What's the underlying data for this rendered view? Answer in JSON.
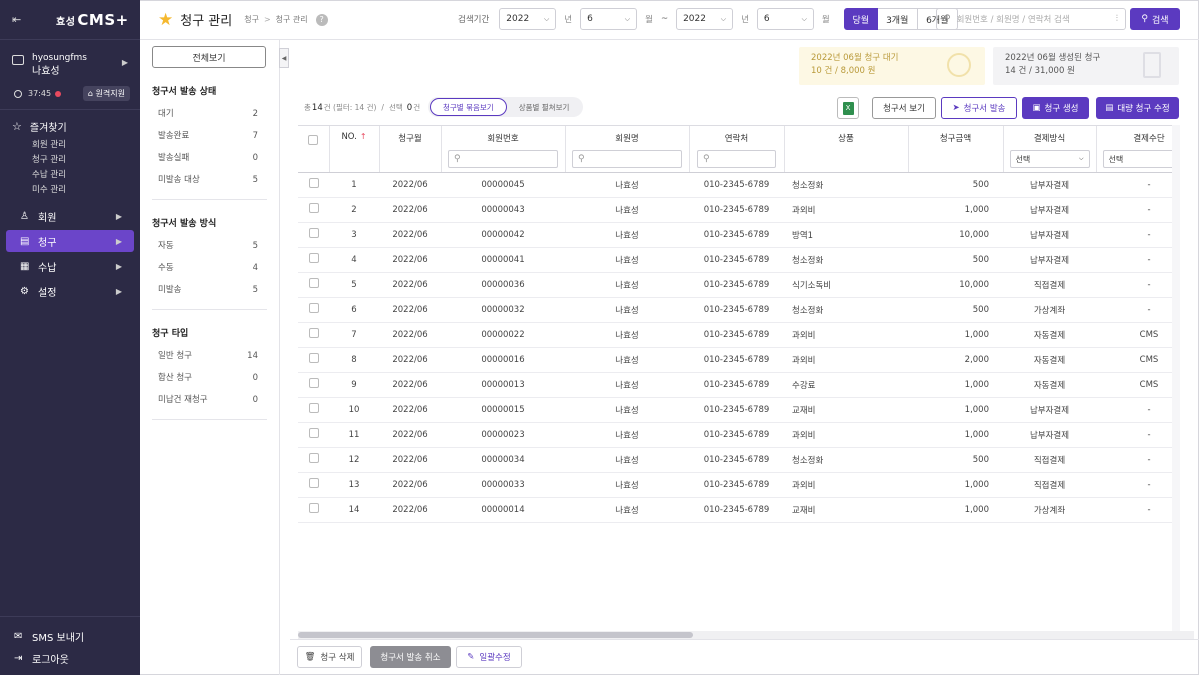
{
  "sidebar": {
    "logo_prefix": "효성",
    "logo_main": "CMS+",
    "user_id": "hyosungfms",
    "user_name": "나효성",
    "session_time": "37:45",
    "remote_label": "원격지원",
    "favorites_title": "즐겨찾기",
    "favorites": [
      "회원 관리",
      "청구 관리",
      "수납 관리",
      "미수 관리"
    ],
    "nav": [
      {
        "label": "회원",
        "icon": "user-icon"
      },
      {
        "label": "청구",
        "icon": "billing-icon",
        "active": true
      },
      {
        "label": "수납",
        "icon": "receipt-icon"
      },
      {
        "label": "설정",
        "icon": "gear-icon"
      }
    ],
    "sms_label": "SMS 보내기",
    "logout_label": "로그아웃"
  },
  "header": {
    "title": "청구 관리",
    "breadcrumb": [
      "청구",
      "청구 관리"
    ],
    "period_label": "검색기간",
    "from_year": "2022",
    "from_month": "6",
    "to_year": "2022",
    "to_month": "6",
    "year_unit": "년",
    "month_unit": "월",
    "tilde": "~",
    "quick_ranges": [
      "당월",
      "3개월",
      "6개월"
    ],
    "search_placeholder": "회원번호 / 회원명 / 연락처 검색",
    "search_button": "검색"
  },
  "filter": {
    "view_all": "전체보기",
    "groups": [
      {
        "title": "청구서 발송 상태",
        "rows": [
          {
            "label": "대기",
            "count": "2"
          },
          {
            "label": "발송완료",
            "count": "7"
          },
          {
            "label": "발송실패",
            "count": "0"
          },
          {
            "label": "미발송 대상",
            "count": "5"
          }
        ]
      },
      {
        "title": "청구서 발송 방식",
        "rows": [
          {
            "label": "자동",
            "count": "5"
          },
          {
            "label": "수동",
            "count": "4"
          },
          {
            "label": "미발송",
            "count": "5"
          }
        ]
      },
      {
        "title": "청구 타입",
        "rows": [
          {
            "label": "일반 청구",
            "count": "14"
          },
          {
            "label": "합산 청구",
            "count": "0"
          },
          {
            "label": "미납건 재청구",
            "count": "0"
          }
        ]
      }
    ]
  },
  "summary": {
    "pending_title": "2022년 06월 청구 대기",
    "pending_value": "10 건 / 8,000 원",
    "created_title": "2022년 06월 생성된 청구",
    "created_value": "14 건 / 31,000 원"
  },
  "toolbar": {
    "total_prefix": "총",
    "total_count": "14",
    "total_suffix": "건 (필터: 14 건)",
    "slash": "/",
    "selected_prefix": "선택",
    "selected_count": "0",
    "selected_suffix": "건",
    "view_modes": [
      "청구별 묶음보기",
      "상품별 펼쳐보기"
    ],
    "excel_glyph": "X",
    "view_invoice": "청구서 보기",
    "send_invoice": "청구서 발송",
    "create_bill": "청구 생성",
    "bulk_edit": "대량 청구 수정"
  },
  "table": {
    "headers": [
      "NO.",
      "청구월",
      "회원번호",
      "회원명",
      "연락처",
      "상품",
      "청구금액",
      "결제방식",
      "결제수단"
    ],
    "select_placeholder": "선택",
    "rows": [
      [
        "1",
        "2022/06",
        "00000045",
        "나효성",
        "010-2345-6789",
        "청소정화",
        "500",
        "납부자결제",
        "-"
      ],
      [
        "2",
        "2022/06",
        "00000043",
        "나효성",
        "010-2345-6789",
        "과외비",
        "1,000",
        "납부자결제",
        "-"
      ],
      [
        "3",
        "2022/06",
        "00000042",
        "나효성",
        "010-2345-6789",
        "방역1",
        "10,000",
        "납부자결제",
        "-"
      ],
      [
        "4",
        "2022/06",
        "00000041",
        "나효성",
        "010-2345-6789",
        "청소정화",
        "500",
        "납부자결제",
        "-"
      ],
      [
        "5",
        "2022/06",
        "00000036",
        "나효성",
        "010-2345-6789",
        "식기소독비",
        "10,000",
        "직접결제",
        "-"
      ],
      [
        "6",
        "2022/06",
        "00000032",
        "나효성",
        "010-2345-6789",
        "청소정화",
        "500",
        "가상계좌",
        "-"
      ],
      [
        "7",
        "2022/06",
        "00000022",
        "나효성",
        "010-2345-6789",
        "과외비",
        "1,000",
        "자동결제",
        "CMS"
      ],
      [
        "8",
        "2022/06",
        "00000016",
        "나효성",
        "010-2345-6789",
        "과외비",
        "2,000",
        "자동결제",
        "CMS"
      ],
      [
        "9",
        "2022/06",
        "00000013",
        "나효성",
        "010-2345-6789",
        "수강료",
        "1,000",
        "자동결제",
        "CMS"
      ],
      [
        "10",
        "2022/06",
        "00000015",
        "나효성",
        "010-2345-6789",
        "교재비",
        "1,000",
        "납부자결제",
        "-"
      ],
      [
        "11",
        "2022/06",
        "00000023",
        "나효성",
        "010-2345-6789",
        "과외비",
        "1,000",
        "납부자결제",
        "-"
      ],
      [
        "12",
        "2022/06",
        "00000034",
        "나효성",
        "010-2345-6789",
        "청소정화",
        "500",
        "직접결제",
        "-"
      ],
      [
        "13",
        "2022/06",
        "00000033",
        "나효성",
        "010-2345-6789",
        "과외비",
        "1,000",
        "직접결제",
        "-"
      ],
      [
        "14",
        "2022/06",
        "00000014",
        "나효성",
        "010-2345-6789",
        "교재비",
        "1,000",
        "가상계좌",
        "-"
      ]
    ]
  },
  "footer": {
    "delete_label": "청구 삭제",
    "cancel_send_label": "청구서 발송 취소",
    "batch_edit_label": "일괄수정"
  },
  "colors": {
    "accent": "#5b3ac0",
    "sidebar": "#2c2a45",
    "star": "#f5b82e"
  }
}
